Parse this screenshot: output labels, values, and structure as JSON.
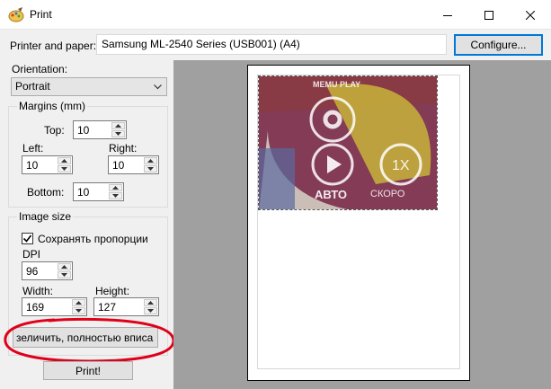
{
  "window": {
    "title": "Print",
    "minimize_icon": "minimize-icon",
    "maximize_icon": "maximize-icon",
    "close_icon": "close-icon"
  },
  "printer": {
    "label": "Printer and paper:",
    "value": "Samsung ML-2540 Series (USB001) (A4)",
    "configure_label": "Configure..."
  },
  "orientation": {
    "label": "Orientation:",
    "selected": "Portrait"
  },
  "margins": {
    "title": "Margins (mm)",
    "top_label": "Top:",
    "top_value": "10",
    "left_label": "Left:",
    "left_value": "10",
    "right_label": "Right:",
    "right_value": "10",
    "bottom_label": "Bottom:",
    "bottom_value": "10"
  },
  "image_size": {
    "title": "Image size",
    "keep_proportions_label": "Сохранять пропорции",
    "keep_proportions_checked": true,
    "dpi_label": "DPI",
    "dpi_value": "96",
    "width_label": "Width:",
    "width_value": "169",
    "height_label": "Height:",
    "height_value": "127",
    "fit_button_label": "зеличить, полностью вписа"
  },
  "print_button_label": "Print!",
  "preview": {
    "logo_text": "MEMU PLAY",
    "button_auto": "АВТО",
    "button_speed": "СКОРО",
    "speed_label": "1X"
  },
  "colors": {
    "accent": "#0078d7",
    "annotation": "#e0001a"
  }
}
